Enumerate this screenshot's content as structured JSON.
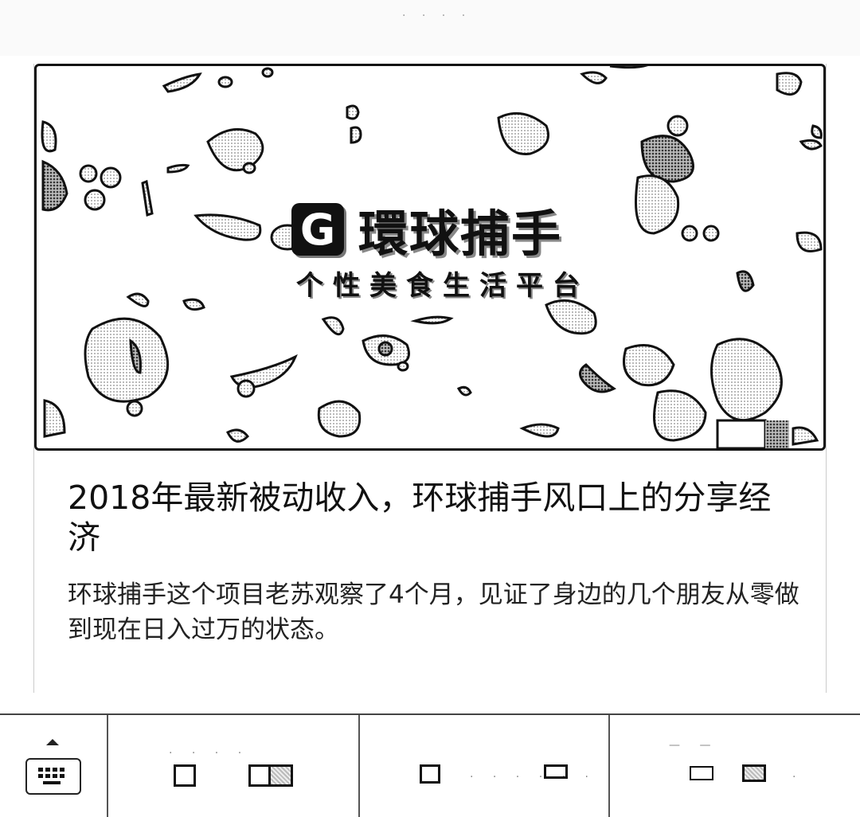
{
  "article": {
    "logo_letter": "G",
    "logo_name": "環球捕手",
    "logo_slogan": "个性美食生活平台",
    "title": "2018年最新被动收入，环球捕手风口上的分享经济",
    "summary": "环球捕手这个项目老苏观察了4个月，见证了身边的几个朋友从零做到现在日入过万的状态。"
  },
  "toolbar": {
    "icons": [
      "keyboard-icon",
      "window-icon",
      "split-window-icon",
      "window-icon",
      "window-icon",
      "window-icon",
      "window-icon"
    ]
  }
}
